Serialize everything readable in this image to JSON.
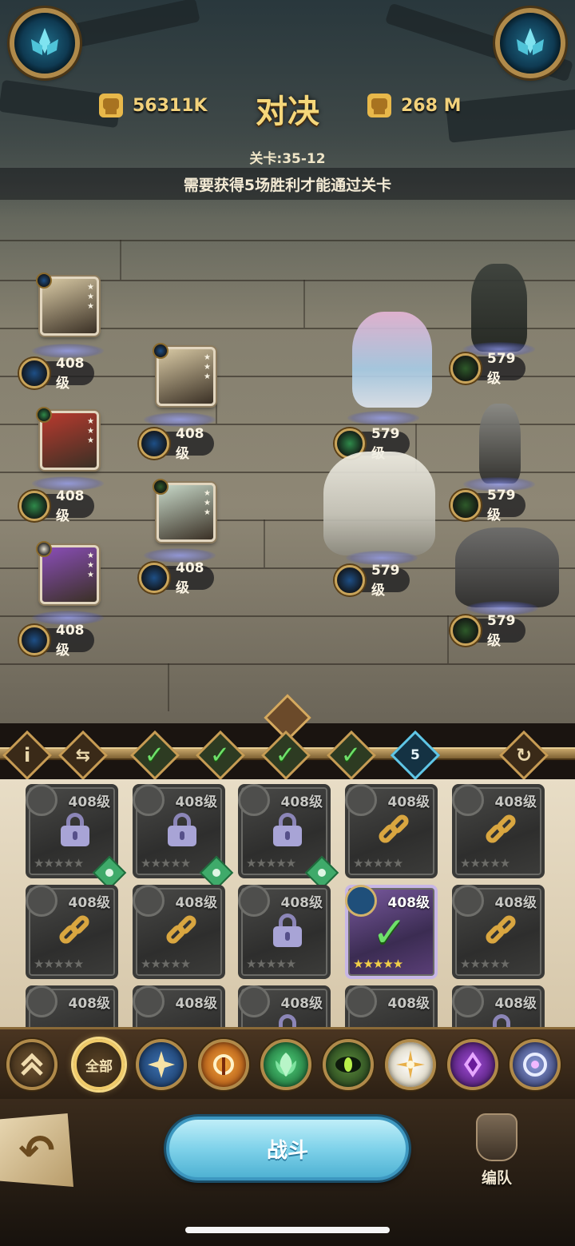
{
  "header": {
    "title": "对决",
    "player_power": "56311K",
    "enemy_power": "268 M",
    "stage_label": "关卡:35-12",
    "requirement": "需要获得5场胜利才能通过关卡"
  },
  "player_team": [
    {
      "level": "408级",
      "faction": "lightbearer",
      "card_color": "#d8c9a4"
    },
    {
      "level": "408级",
      "faction": "lightbearer",
      "card_color": "#d8c9a4"
    },
    {
      "level": "408级",
      "faction": "wilder",
      "card_color": "#b83a2e"
    },
    {
      "level": "408级",
      "faction": "graveborn",
      "card_color": "#c7d8c8"
    },
    {
      "level": "408级",
      "faction": "celestial",
      "card_color": "#8a4eb8"
    }
  ],
  "enemy_team": [
    {
      "level": "579级",
      "faction": "graveborn"
    },
    {
      "level": "579级",
      "faction": "wilder"
    },
    {
      "level": "579级",
      "faction": "graveborn"
    },
    {
      "level": "579级",
      "faction": "lightbearer"
    },
    {
      "level": "579级",
      "faction": "graveborn"
    }
  ],
  "strip": {
    "info_icon": "info-icon",
    "swap_icon": "swap-icon",
    "completed_battles": 4,
    "current_battle": "5",
    "reset_icon": "reset-icon"
  },
  "hero_grid": [
    {
      "level": "408级",
      "state": "locked",
      "assist": true
    },
    {
      "level": "408级",
      "state": "locked",
      "assist": true
    },
    {
      "level": "408级",
      "state": "locked",
      "assist": true
    },
    {
      "level": "408级",
      "state": "linked",
      "assist": false
    },
    {
      "level": "408级",
      "state": "linked",
      "assist": false
    },
    {
      "level": "408级",
      "state": "linked",
      "assist": false
    },
    {
      "level": "408级",
      "state": "linked",
      "assist": false
    },
    {
      "level": "408级",
      "state": "locked",
      "assist": false
    },
    {
      "level": "408级",
      "state": "selected",
      "assist": false
    },
    {
      "level": "408级",
      "state": "linked",
      "assist": false
    },
    {
      "level": "408级",
      "state": "available",
      "assist": false
    },
    {
      "level": "408级",
      "state": "available",
      "assist": false
    },
    {
      "level": "408级",
      "state": "locked",
      "assist": false
    },
    {
      "level": "408级",
      "state": "available",
      "assist": false
    },
    {
      "level": "408级",
      "state": "locked",
      "assist": false
    }
  ],
  "stars": "★★★★★",
  "filters": {
    "collapse_icon": "double-chevron-up-icon",
    "all_label": "全部",
    "factions": [
      "lightbearer",
      "mauler",
      "wilder",
      "graveborn",
      "celestial",
      "hypogean",
      "dimensional"
    ]
  },
  "footer": {
    "back_icon": "back-arrow-icon",
    "back_glyph": "↶",
    "fight_label": "战斗",
    "formation_label": "编队"
  },
  "colors": {
    "lightbearer": "#1e4f86",
    "mauler": "#b8561e",
    "wilder": "#2f8a4a",
    "graveborn": "#2e5a2a",
    "celestial": "#e8e2d0",
    "hypogean": "#5a2a8a",
    "dimensional": "#4a5a8a",
    "accent_gold": "#c9a45a",
    "check_green": "#6ee06a"
  }
}
